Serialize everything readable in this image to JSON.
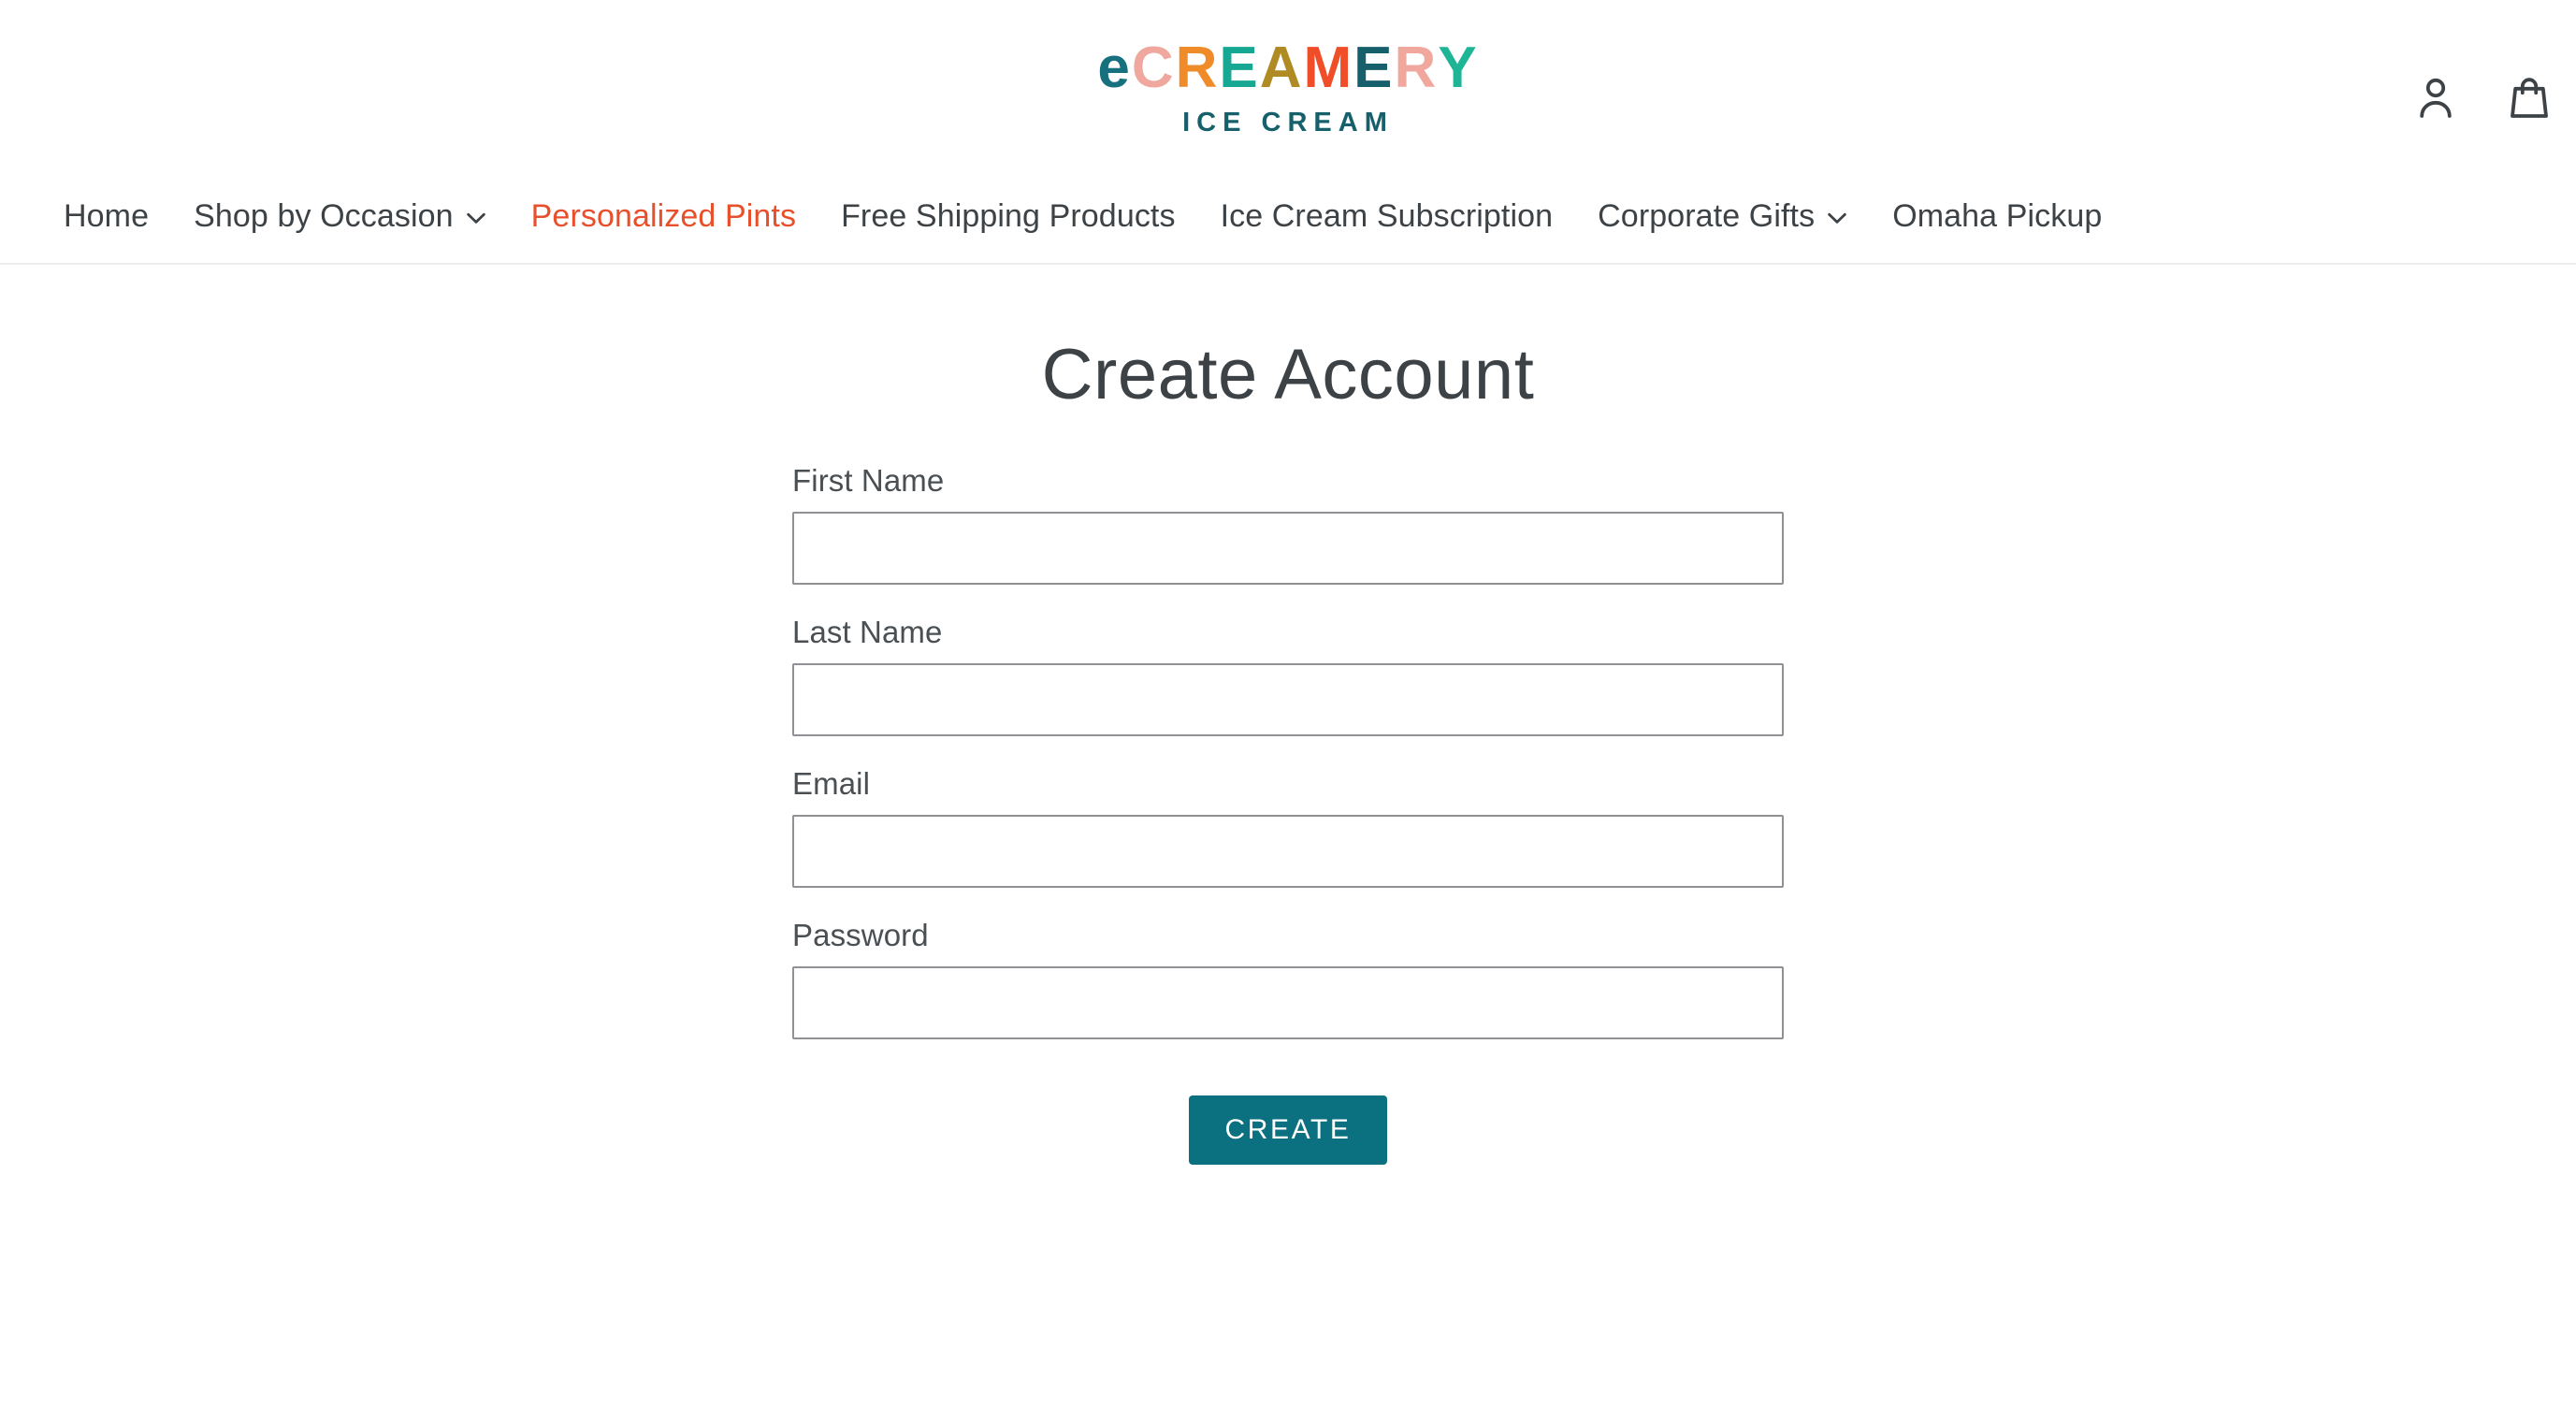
{
  "theme": {
    "page_background": "#ffffff",
    "text_color": "#3d4246",
    "accent_orange": "#e8502c",
    "accent_teal": "#0b7180",
    "input_border": "#8f9194",
    "divider": "#ededed"
  },
  "header": {
    "logo": {
      "word_letters": [
        {
          "char": "e",
          "color": "#16707d"
        },
        {
          "char": "C",
          "color": "#efa79e"
        },
        {
          "char": "R",
          "color": "#ef8b29"
        },
        {
          "char": "E",
          "color": "#17a894"
        },
        {
          "char": "A",
          "color": "#b08a23"
        },
        {
          "char": "M",
          "color": "#f04e28"
        },
        {
          "char": "E",
          "color": "#15606b"
        },
        {
          "char": "R",
          "color": "#efa79e"
        },
        {
          "char": "Y",
          "color": "#1eb496"
        }
      ],
      "word_text": "eCREAMERY",
      "subtitle": "ICE CREAM",
      "subtitle_color": "#15606b"
    },
    "icons": [
      {
        "name": "account-icon",
        "label": "Log in"
      },
      {
        "name": "cart-icon",
        "label": "Cart"
      }
    ]
  },
  "nav": {
    "items": [
      {
        "label": "Home",
        "active": false,
        "has_dropdown": false
      },
      {
        "label": "Shop by Occasion",
        "active": false,
        "has_dropdown": true
      },
      {
        "label": "Personalized Pints",
        "active": true,
        "has_dropdown": false
      },
      {
        "label": "Free Shipping Products",
        "active": false,
        "has_dropdown": false
      },
      {
        "label": "Ice Cream Subscription",
        "active": false,
        "has_dropdown": false
      },
      {
        "label": "Corporate Gifts",
        "active": false,
        "has_dropdown": true
      },
      {
        "label": "Omaha Pickup",
        "active": false,
        "has_dropdown": false
      }
    ]
  },
  "main": {
    "title": "Create Account",
    "form": {
      "fields": [
        {
          "label": "First Name",
          "value": "",
          "placeholder": "",
          "type": "text",
          "name": "first-name-field"
        },
        {
          "label": "Last Name",
          "value": "",
          "placeholder": "",
          "type": "text",
          "name": "last-name-field"
        },
        {
          "label": "Email",
          "value": "",
          "placeholder": "",
          "type": "email",
          "name": "email-field"
        },
        {
          "label": "Password",
          "value": "",
          "placeholder": "",
          "type": "password",
          "name": "password-field"
        }
      ],
      "submit_label": "CREATE"
    }
  }
}
